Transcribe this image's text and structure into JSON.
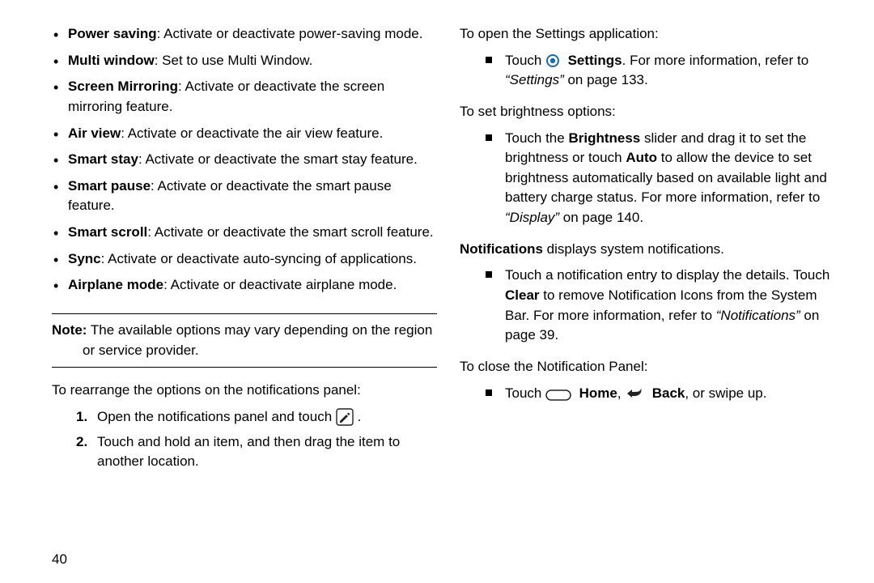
{
  "left": {
    "features": [
      {
        "term": "Power saving",
        "desc": ": Activate or deactivate power-saving mode."
      },
      {
        "term": "Multi window",
        "desc": ": Set to use Multi Window."
      },
      {
        "term": "Screen Mirroring",
        "desc": ": Activate or deactivate the screen mirroring feature."
      },
      {
        "term": "Air view",
        "desc": ": Activate or deactivate the air view feature."
      },
      {
        "term": "Smart stay",
        "desc": ": Activate or deactivate the smart stay feature."
      },
      {
        "term": "Smart pause",
        "desc": ": Activate or deactivate the smart pause feature."
      },
      {
        "term": "Smart scroll",
        "desc": ": Activate or deactivate the smart scroll feature."
      },
      {
        "term": "Sync",
        "desc": ": Activate or deactivate auto-syncing of applications."
      },
      {
        "term": "Airplane mode",
        "desc": ": Activate or deactivate airplane mode."
      }
    ],
    "note_label": "Note:",
    "note_body": " The available options may vary depending on the region or service provider.",
    "rearrange_lead": "To rearrange the options on the notifications panel:",
    "step1_num": "1.",
    "step1_a": "Open the notifications panel and touch ",
    "step1_b": ".",
    "step2_num": "2.",
    "step2": "Touch and hold an item, and then drag the item to another location."
  },
  "right": {
    "open_lead": "To open the Settings application:",
    "open_a": "Touch ",
    "open_b": "Settings",
    "open_c": ". For more information, refer to ",
    "open_ref": "“Settings”",
    "open_d": " on page 133.",
    "bright_lead": "To set brightness options:",
    "bright_a": "Touch the ",
    "bright_b": "Brightness",
    "bright_c": " slider and drag it to set the brightness or touch ",
    "bright_d": "Auto",
    "bright_e": " to allow the device to set brightness automatically based on available light and battery charge status. For more information, refer to ",
    "bright_ref": "“Display”",
    "bright_f": " on page 140.",
    "notif_a": "Notifications",
    "notif_b": " displays system notifications.",
    "notif_item_a": "Touch a notification entry to display the details. Touch ",
    "notif_item_b": "Clear",
    "notif_item_c": " to remove Notification Icons from the System Bar. For more information, refer to ",
    "notif_ref": "“Notifications”",
    "notif_item_d": " on page 39.",
    "close_lead": "To close the Notification Panel:",
    "close_a": "Touch ",
    "close_home": "Home",
    "close_sep": ", ",
    "close_back": "Back",
    "close_b": ", or swipe up."
  },
  "page_number": "40"
}
